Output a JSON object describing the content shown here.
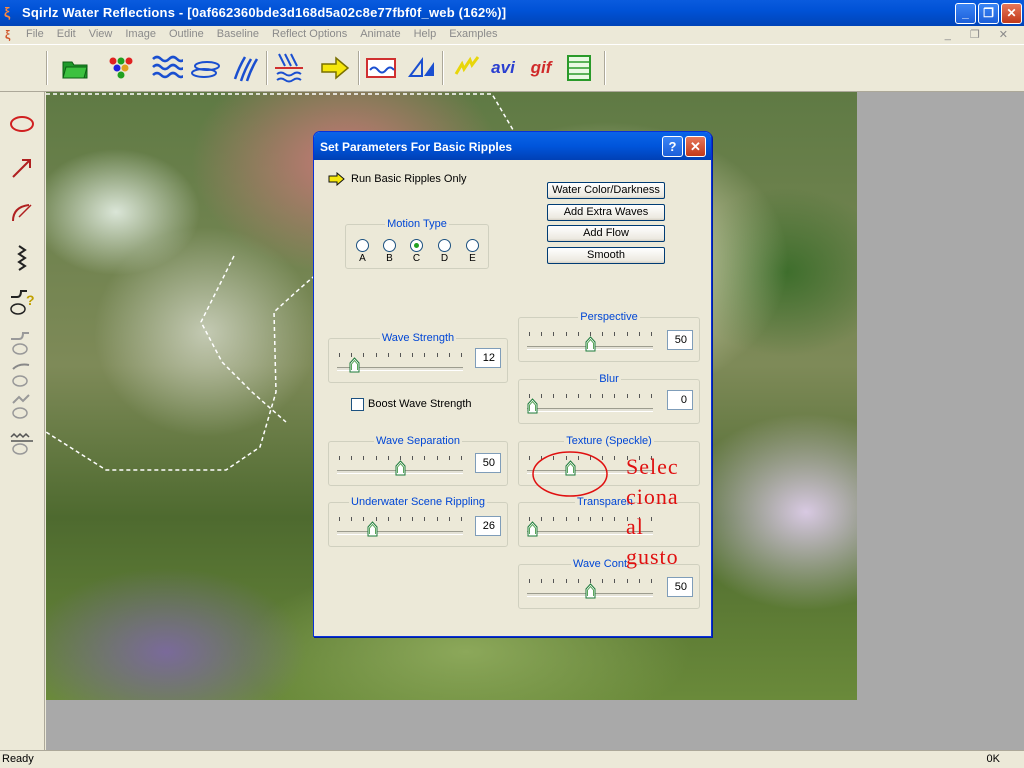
{
  "window": {
    "title": "Sqirlz Water Reflections - [0af662360bde3d168d5a02c8e77fbf0f_web  (162%)]",
    "minimize": "_",
    "restore": "❐",
    "close": "✕"
  },
  "menu": {
    "icon": "ξ",
    "items": [
      "File",
      "Edit",
      "View",
      "Image",
      "Outline",
      "Baseline",
      "Reflect Options",
      "Animate",
      "Help",
      "Examples"
    ],
    "mdi_controls": "_ ❐ ✕"
  },
  "toolbar": {
    "icons": [
      "open-folder-icon",
      "colors-icon",
      "waves-icon",
      "ripple-icon",
      "lines-icon",
      "reflect-icon",
      "arrow-icon",
      "picture-icon",
      "triangle-icon",
      "lightning-icon",
      "avi-icon",
      "gif-icon",
      "window-icon"
    ],
    "avi_label": "avi",
    "gif_label": "gif"
  },
  "tools": [
    "ellipse-tool-icon",
    "arrow-tool-icon",
    "curve-tool-icon",
    "zigzag-tool-icon",
    "help-tool-icon",
    "tool-6-icon",
    "tool-7-icon",
    "tool-8-icon",
    "tool-9-icon"
  ],
  "dialog": {
    "title": "Set Parameters For Basic Ripples",
    "help_btn": "?",
    "close_btn": "✕",
    "run_label": "Run Basic Ripples Only",
    "buttons": [
      "Water Color/Darkness",
      "Add Extra Waves",
      "Add Flow",
      "Smooth"
    ],
    "motion_type": {
      "label": "Motion Type",
      "options": [
        "A",
        "B",
        "C",
        "D",
        "E"
      ],
      "selected": "C"
    },
    "boost_label": "Boost Wave Strength",
    "boost_checked": false,
    "sliders": {
      "wave_strength": {
        "label": "Wave Strength",
        "value": "12",
        "level": 0.1
      },
      "wave_separation": {
        "label": "Wave Separation",
        "value": "50",
        "level": 0.5
      },
      "underwater": {
        "label": "Underwater Scene Rippling",
        "value": "26",
        "level": 0.26
      },
      "perspective": {
        "label": "Perspective",
        "value": "50",
        "level": 0.5
      },
      "blur": {
        "label": "Blur",
        "value": "0",
        "level": 0.0
      },
      "texture": {
        "label": "Texture (Speckle)",
        "value": "",
        "level": 0.33
      },
      "transparency": {
        "label": "Transparen",
        "value": "",
        "level": 0.0
      },
      "wave_cont": {
        "label": "Wave Cont",
        "value": "50",
        "level": 0.5
      }
    }
  },
  "annotation": {
    "lines": [
      "Selec",
      "ciona",
      "al",
      "gusto"
    ],
    "color": "#e01010"
  },
  "status": {
    "left": "Ready",
    "right": "0K"
  }
}
